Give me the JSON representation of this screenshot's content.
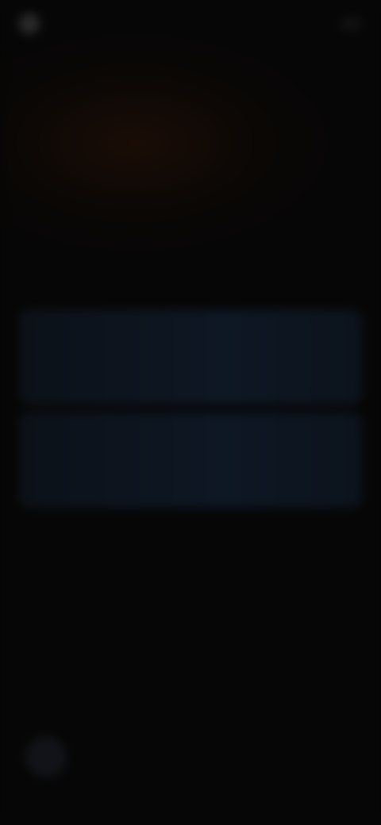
{
  "header": {
    "logo_text": "",
    "action_label": ""
  },
  "hero": {
    "line1_white": "",
    "line1_orange": "",
    "line2_orange": "",
    "line2_white": ""
  },
  "cards": [
    {
      "title": "",
      "subtitle": ""
    },
    {
      "title": "",
      "subtitle": ""
    }
  ],
  "colors": {
    "background": "#060606",
    "accent": "#b5542a",
    "card": "#0e1724"
  },
  "icons": {
    "logo": "logo-icon",
    "fab": "chat-icon"
  }
}
